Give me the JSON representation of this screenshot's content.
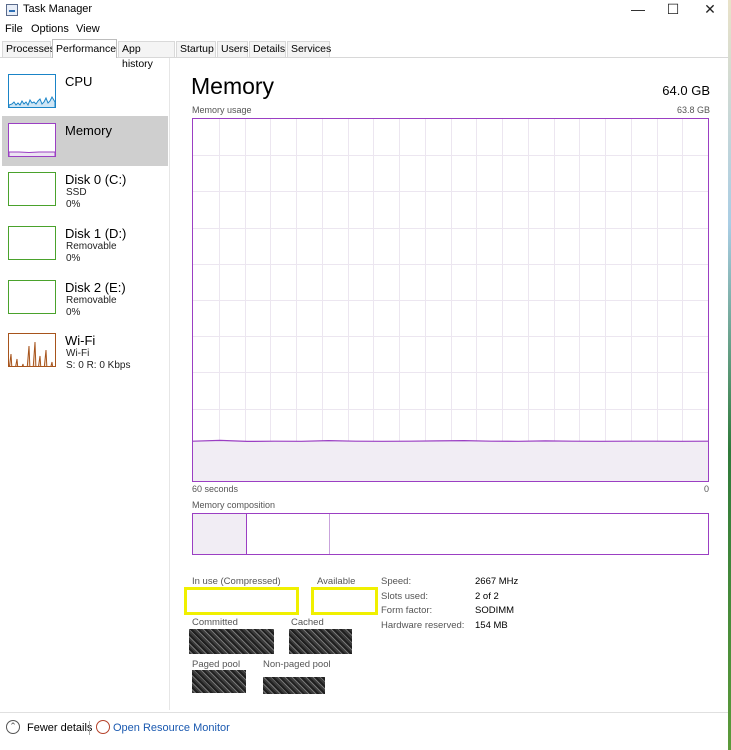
{
  "window": {
    "title": "Task Manager",
    "controls": {
      "minimize": "—",
      "maximize": "☐",
      "close": "✕"
    }
  },
  "menu": [
    "File",
    "Options",
    "View"
  ],
  "tabs": [
    "Processes",
    "Performance",
    "App history",
    "Startup",
    "Users",
    "Details",
    "Services"
  ],
  "active_tab": "Performance",
  "sidebar": {
    "items": [
      {
        "name": "CPU",
        "sub1": "",
        "sub2": "",
        "color": "#1a84c7"
      },
      {
        "name": "Memory",
        "sub1": "",
        "sub2": "",
        "color": "#9b3fc3",
        "selected": true
      },
      {
        "name": "Disk 0 (C:)",
        "sub1": "SSD",
        "sub2": "0%",
        "color": "#4aa22c"
      },
      {
        "name": "Disk 1 (D:)",
        "sub1": "Removable",
        "sub2": "0%",
        "color": "#4aa22c"
      },
      {
        "name": "Disk 2 (E:)",
        "sub1": "Removable",
        "sub2": "0%",
        "color": "#4aa22c"
      },
      {
        "name": "Wi-Fi",
        "sub1": "Wi-Fi",
        "sub2": "S: 0 R: 0 Kbps",
        "color": "#a7541c"
      }
    ]
  },
  "main": {
    "title": "Memory",
    "total": "64.0 GB",
    "usage_label": "Memory usage",
    "usage_max": "63.8 GB",
    "axis_left": "60 seconds",
    "axis_right": "0",
    "composition_label": "Memory composition",
    "usage_fraction": 0.11
  },
  "stats": {
    "in_use_label": "In use (Compressed)",
    "available_label": "Available",
    "committed_label": "Committed",
    "cached_label": "Cached",
    "paged_pool_label": "Paged pool",
    "nonpaged_pool_label": "Non-paged pool",
    "speed_label": "Speed:",
    "speed_value": "2667 MHz",
    "slots_label": "Slots used:",
    "slots_value": "2 of 2",
    "form_label": "Form factor:",
    "form_value": "SODIMM",
    "hwres_label": "Hardware reserved:",
    "hwres_value": "154 MB"
  },
  "footer": {
    "fewer_details": "Fewer details",
    "open_resource_monitor": "Open Resource Monitor"
  },
  "colors": {
    "memory_accent": "#9b3fc3",
    "highlight": "#f0f000",
    "link": "#1a59b0"
  }
}
